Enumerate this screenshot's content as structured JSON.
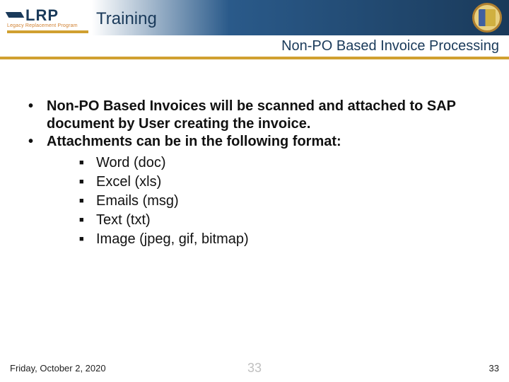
{
  "header": {
    "logo_text": "LRP",
    "logo_sub": "Legacy Replacement Program",
    "title": "Training"
  },
  "subtitle": "Non-PO Based Invoice Processing",
  "content": {
    "bullets": [
      "Non-PO Based Invoices will be scanned and attached to SAP document by User creating the invoice.",
      "Attachments can be in the following format:"
    ],
    "sub_bullets": [
      "Word (doc)",
      "Excel (xls)",
      "Emails (msg)",
      "Text (txt)",
      "Image (jpeg, gif, bitmap)"
    ]
  },
  "footer": {
    "date": "Friday, October 2, 2020",
    "center": "33",
    "page": "33"
  }
}
